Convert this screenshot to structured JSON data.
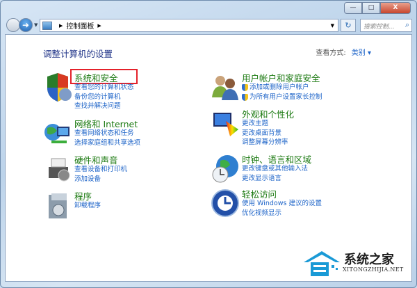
{
  "window": {
    "minimize_label": "—",
    "maximize_label": "□",
    "close_label": "X"
  },
  "address": {
    "path": "控制面板",
    "refresh": "↻"
  },
  "search": {
    "placeholder": "搜索控制..."
  },
  "main": {
    "heading": "调整计算机的设置",
    "view_by_label": "查看方式:",
    "view_by_value": "类别 ▾",
    "categories": [
      {
        "title": "系统和安全",
        "links": [
          "查看您的计算机状态",
          "备份您的计算机",
          "查找并解决问题"
        ]
      },
      {
        "title": "网络和 Internet",
        "links": [
          "查看网络状态和任务",
          "选择家庭组和共享选项"
        ]
      },
      {
        "title": "硬件和声音",
        "links": [
          "查看设备和打印机",
          "添加设备"
        ]
      },
      {
        "title": "程序",
        "links": [
          "卸载程序"
        ]
      },
      {
        "title": "用户帐户和家庭安全",
        "links": [
          "添加或删除用户帐户",
          "为所有用户设置家长控制"
        ]
      },
      {
        "title": "外观和个性化",
        "links": [
          "更改主题",
          "更改桌面背景",
          "调整屏幕分辨率"
        ]
      },
      {
        "title": "时钟、语言和区域",
        "links": [
          "更改键盘或其他输入法",
          "更改显示语言"
        ]
      },
      {
        "title": "轻松访问",
        "links": [
          "使用 Windows 建议的设置",
          "优化视频显示"
        ]
      }
    ]
  },
  "watermark": {
    "name": "系统之家",
    "url": "XITONGZHIJIA.NET"
  }
}
